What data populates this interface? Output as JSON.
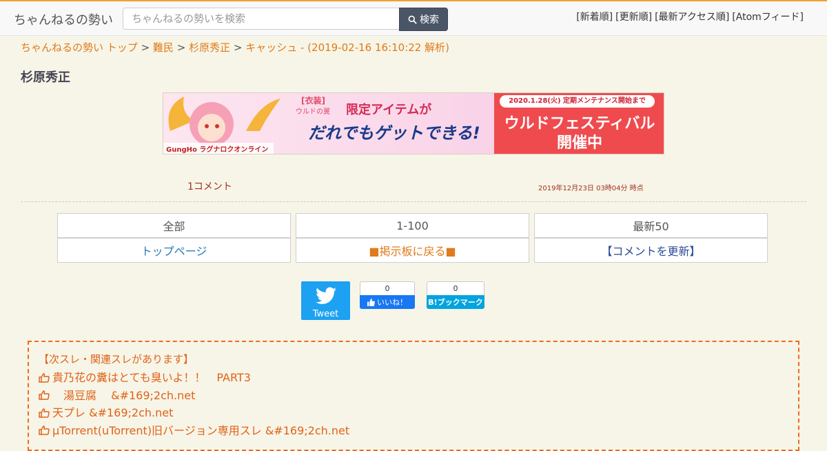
{
  "header": {
    "brand": "ちゃんねるの勢い",
    "search_placeholder": "ちゃんねるの勢いを検索",
    "search_button": "検索",
    "nav": [
      "[新着順]",
      "[更新順]",
      "[最新アクセス順]",
      "[Atomフィード]"
    ]
  },
  "breadcrumb": {
    "items": [
      "ちゃんねるの勢い トップ",
      "難民",
      "杉原秀正",
      "キャッシュ - (2019-02-16 16:10:22 解析)"
    ],
    "separator": ">"
  },
  "page_title": "杉原秀正",
  "banner": {
    "date_text": "2020.1.28(火) 定期メンテナンス開始まで",
    "main_text": "ウルドフェスティバル",
    "main_text2": "開催中",
    "tag_text": "[衣装]",
    "tag_sub": "ウルドの翼",
    "headline1": "限定アイテムが",
    "headline2": "だれでもゲットできる!",
    "logo_text": "GungHo ラグナロクオンライン"
  },
  "stats": {
    "comment_count": "1コメント",
    "timestamp": "2019年12月23日 03時04分 時点"
  },
  "navgrid": {
    "all": "全部",
    "range": "1-100",
    "latest": "最新50",
    "top_page": "トップページ",
    "back_to_board": "■掲示板に戻る■",
    "refresh_comments": "【コメントを更新】"
  },
  "social": {
    "tweet": "Tweet",
    "fb_count": "0",
    "fb_like": "いいね！",
    "hatena_count": "0",
    "hatena_label": "B!ブックマーク"
  },
  "related": {
    "heading": "【次スレ・関連スレがあります】",
    "items": [
      "貴乃花の糞はとても臭いよ！！　PART3",
      "　湯豆腐　 &#169;2ch.net",
      "天プレ &#169;2ch.net",
      "μTorrent(uTorrent)旧バージョン専用スレ &#169;2ch.net"
    ]
  },
  "colors": {
    "accent_orange": "#e07a1a",
    "link_blue": "#2a6db5",
    "dark_red": "#a03020",
    "search_button_bg": "#4a5566"
  }
}
